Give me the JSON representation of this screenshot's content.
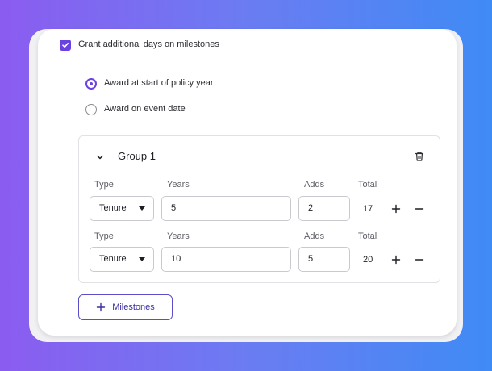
{
  "milestones": {
    "grant_label": "Grant additional days on milestones",
    "grant_checked": true,
    "award_options": [
      {
        "label": "Award at start of policy year",
        "selected": true
      },
      {
        "label": "Award on event date",
        "selected": false
      }
    ]
  },
  "group": {
    "title": "Group 1",
    "columns": {
      "type": "Type",
      "years": "Years",
      "adds": "Adds",
      "total": "Total"
    },
    "rows": [
      {
        "type": "Tenure",
        "years": "5",
        "adds": "2",
        "total": "17"
      },
      {
        "type": "Tenure",
        "years": "10",
        "adds": "5",
        "total": "20"
      }
    ]
  },
  "add_button": {
    "label": "Milestones"
  },
  "icons": {
    "checkbox": "check-icon",
    "collapse": "chevron-down-icon",
    "delete": "trash-icon",
    "select": "caret-down-icon",
    "add": "plus-icon",
    "remove": "minus-icon"
  },
  "colors": {
    "accent": "#6a42e0",
    "button_text": "#3a2f9e",
    "border": "#c9c9d0"
  }
}
